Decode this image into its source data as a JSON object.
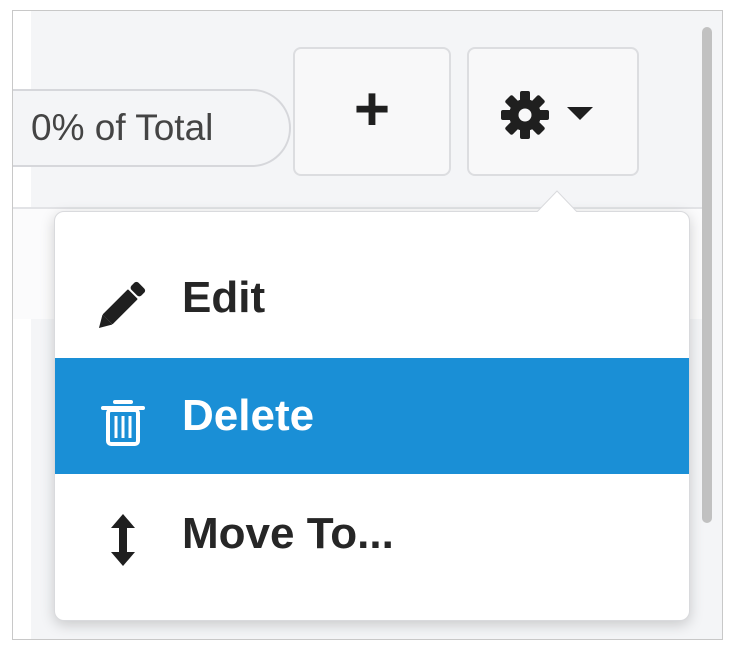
{
  "header": {
    "percent_pill": "0% of Total",
    "add_button": "+"
  },
  "menu": {
    "items": [
      {
        "label": "Edit",
        "icon": "pencil-icon",
        "active": false
      },
      {
        "label": "Delete",
        "icon": "trash-icon",
        "active": true
      },
      {
        "label": "Move To...",
        "icon": "vertical-arrows-icon",
        "active": false
      }
    ]
  },
  "colors": {
    "active_item_bg": "#1a8fd6",
    "active_item_text": "#ffffff",
    "item_text": "#262626"
  }
}
